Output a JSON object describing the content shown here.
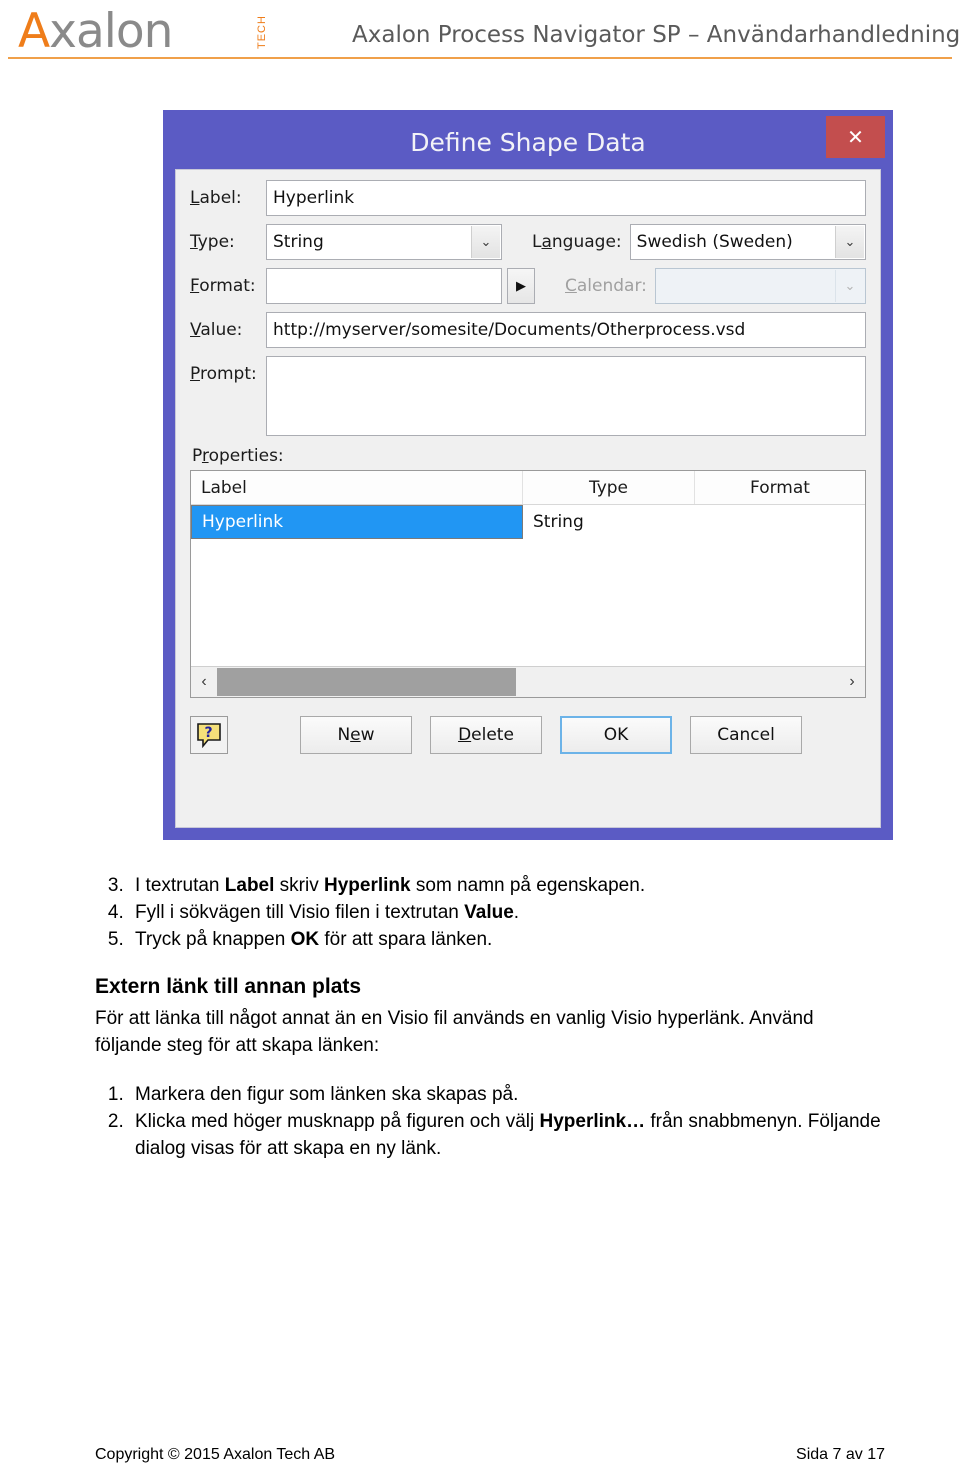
{
  "header": {
    "logo_main": "Axalon",
    "logo_a": "A",
    "logo_rest": "xalon",
    "logo_tech": "TECH",
    "title": "Axalon Process Navigator SP – Användarhandledning"
  },
  "dialog": {
    "title": "Define Shape Data",
    "close_label": "✕",
    "fields": {
      "label_caption": "Label:",
      "label_value": "Hyperlink",
      "type_caption": "Type:",
      "type_value": "String",
      "language_caption": "Language:",
      "language_value": "Swedish (Sweden)",
      "format_caption": "Format:",
      "format_value": "",
      "format_button": "▶",
      "calendar_caption": "Calendar:",
      "calendar_value": "",
      "value_caption": "Value:",
      "value_value": "http://myserver/somesite/Documents/Otherprocess.vsd",
      "prompt_caption": "Prompt:",
      "prompt_value": "",
      "dropdown_arrow": "⌄"
    },
    "properties_caption": "Properties:",
    "grid": {
      "columns": [
        "Label",
        "Type",
        "Format"
      ],
      "rows": [
        {
          "label": "Hyperlink",
          "type": "String",
          "format": ""
        }
      ]
    },
    "scrollbar": {
      "left_arrow": "‹",
      "right_arrow": "›"
    },
    "buttons": {
      "help": "?",
      "new": "New",
      "delete": "Delete",
      "ok": "OK",
      "cancel": "Cancel"
    }
  },
  "doc": {
    "steps1_start": 3,
    "steps1": [
      "I textrutan <b>Label</b> skriv <b>Hyperlink</b> som namn på egenskapen.",
      "Fyll i sökvägen till Visio filen i textrutan <b>Value</b>.",
      "Tryck på knappen <b>OK</b> för att spara länken."
    ],
    "heading": "Extern länk till annan plats",
    "paragraph": "För att länka till något annat än en Visio fil används en vanlig Visio hyperlänk. Använd följande steg för att skapa länken:",
    "steps2_start": 1,
    "steps2": [
      "Markera den figur som länken ska skapas på.",
      "Klicka med höger musknapp på figuren och välj <b>Hyperlink…</b> från snabbmenyn. Följande dialog visas för att skapa en ny länk."
    ]
  },
  "footer": {
    "copyright": "Copyright © 2015 Axalon Tech AB",
    "page": "Sida 7 av 17"
  },
  "colors": {
    "accent_orange": "#ef7d1a",
    "dialog_purple": "#5b5bc4",
    "close_red": "#c34e4e",
    "selection_blue": "#2196f3"
  }
}
